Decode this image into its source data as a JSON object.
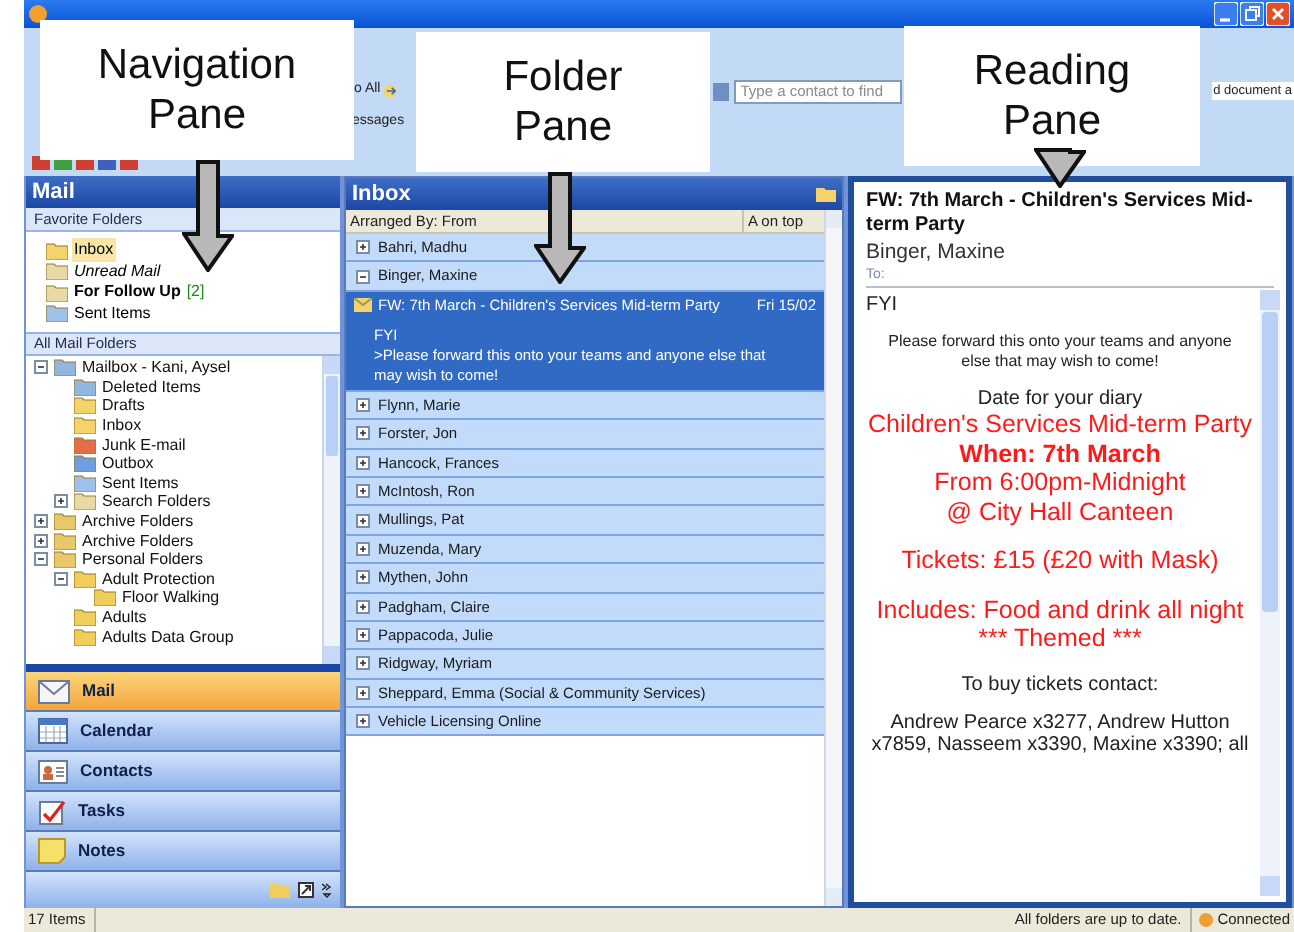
{
  "callouts": [
    {
      "label": "Navigation Pane"
    },
    {
      "label": "Folder Pane"
    },
    {
      "label": "Reading Pane"
    }
  ],
  "toolbar": {
    "reply_all": "o All",
    "messages": "essages",
    "contact_search": {
      "placeholder": "Type a contact to find"
    },
    "document_box": "d document a"
  },
  "navigation": {
    "title": "Mail",
    "favorites_header": "Favorite Folders",
    "favorites": [
      {
        "label": "Inbox",
        "kind": "inbox",
        "selected": true
      },
      {
        "label": "Unread Mail",
        "kind": "search",
        "selected": false
      },
      {
        "label": "For Follow Up",
        "count": "[2]",
        "kind": "search",
        "selected": false
      },
      {
        "label": "Sent Items",
        "kind": "sent",
        "selected": false
      }
    ],
    "all_folders_header": "All Mail Folders",
    "tree": [
      {
        "label": "Mailbox - Kani, Aysel",
        "kind": "mailbox",
        "expanded": true,
        "children": [
          {
            "label": "Deleted Items",
            "kind": "deleted"
          },
          {
            "label": "Drafts",
            "kind": "drafts"
          },
          {
            "label": "Inbox",
            "kind": "inbox"
          },
          {
            "label": "Junk E-mail",
            "kind": "junk"
          },
          {
            "label": "Outbox",
            "kind": "outbox"
          },
          {
            "label": "Sent Items",
            "kind": "sent"
          },
          {
            "label": "Search Folders",
            "kind": "search",
            "expanded": false
          }
        ]
      },
      {
        "label": "Archive Folders",
        "kind": "archive",
        "expanded": false
      },
      {
        "label": "Archive Folders",
        "kind": "archive",
        "expanded": false
      },
      {
        "label": "Personal Folders",
        "kind": "archive",
        "expanded": true,
        "children": [
          {
            "label": "Adult Protection",
            "kind": "folder",
            "expanded": true,
            "children": [
              {
                "label": "Floor Walking",
                "kind": "folder"
              }
            ]
          },
          {
            "label": "Adults",
            "kind": "folder"
          },
          {
            "label": "Adults Data Group",
            "kind": "folder"
          }
        ]
      }
    ],
    "buttons": [
      {
        "label": "Mail",
        "kind": "mail",
        "selected": true
      },
      {
        "label": "Calendar",
        "kind": "calendar",
        "selected": false
      },
      {
        "label": "Contacts",
        "kind": "contacts",
        "selected": false
      },
      {
        "label": "Tasks",
        "kind": "tasks",
        "selected": false
      },
      {
        "label": "Notes",
        "kind": "notes",
        "selected": false
      }
    ]
  },
  "folder": {
    "title": "Inbox",
    "arranged_by": "Arranged By: From",
    "sort_order": "A on top",
    "groups": [
      {
        "name": "Bahri, Madhu",
        "expanded": false
      },
      {
        "name": "Binger, Maxine",
        "expanded": true,
        "messages": [
          {
            "subject": "FW: 7th March - Children's Services Mid-term Party",
            "date": "Fri 15/02",
            "preview": [
              "FYI",
              ">Please forward this onto your teams and anyone else that may wish to come!"
            ],
            "selected": true
          }
        ]
      },
      {
        "name": "Flynn, Marie",
        "expanded": false
      },
      {
        "name": "Forster, Jon",
        "expanded": false
      },
      {
        "name": "Hancock, Frances",
        "expanded": false
      },
      {
        "name": "McIntosh, Ron",
        "expanded": false
      },
      {
        "name": "Mullings, Pat",
        "expanded": false
      },
      {
        "name": "Muzenda, Mary",
        "expanded": false
      },
      {
        "name": "Mythen, John",
        "expanded": false
      },
      {
        "name": "Padgham, Claire",
        "expanded": false
      },
      {
        "name": "Pappacoda, Julie",
        "expanded": false
      },
      {
        "name": "Ridgway, Myriam",
        "expanded": false
      },
      {
        "name": "Sheppard, Emma (Social & Community Services)",
        "expanded": false
      },
      {
        "name": "Vehicle Licensing Online",
        "expanded": false
      }
    ]
  },
  "reading": {
    "subject": "FW: 7th March - Children's Services Mid-term Party",
    "sender": "Binger, Maxine",
    "to_label": "To:",
    "body": [
      {
        "kind": "plain",
        "text": "FYI"
      },
      {
        "kind": "small",
        "text": "Please forward this onto your teams and anyone else that may wish to come!"
      },
      {
        "kind": "center",
        "text": "Date for your diary"
      },
      {
        "kind": "red",
        "text": "Children's Services Mid-term Party"
      },
      {
        "kind": "red_bold",
        "text": "When: 7th March"
      },
      {
        "kind": "red",
        "text": "From 6:00pm-Midnight"
      },
      {
        "kind": "red",
        "text": "@ City Hall Canteen"
      },
      {
        "kind": "red_gap",
        "text": "Tickets: £15 (£20 with Mask)"
      },
      {
        "kind": "red_gap",
        "text": "Includes: Food and drink all night"
      },
      {
        "kind": "red",
        "text": "***   Themed   ***"
      },
      {
        "kind": "center_gap",
        "text": "To buy tickets contact:"
      },
      {
        "kind": "center",
        "text": "Andrew Pearce x3277, Andrew Hutton x7859, Nasseem x3390, Maxine x3390; all"
      }
    ]
  },
  "status_bar": {
    "items": "17 Items",
    "sync": "All folders are up to date.",
    "connection": "Connected"
  }
}
